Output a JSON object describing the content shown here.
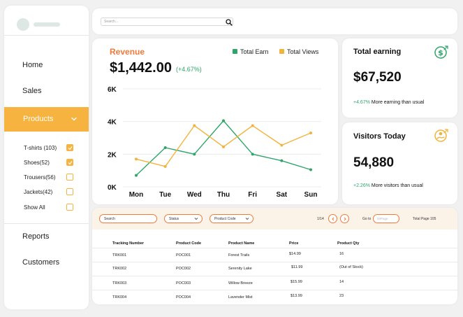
{
  "sidebar": {
    "nav_top": [
      {
        "label": "Home"
      },
      {
        "label": "Sales"
      }
    ],
    "active": {
      "label": "Products"
    },
    "categories": [
      {
        "label": "T-shirts (103)",
        "checked": true
      },
      {
        "label": "Shoes(52)",
        "checked": true
      },
      {
        "label": "Trousers(56)",
        "checked": false
      },
      {
        "label": "Jackets(42)",
        "checked": false
      },
      {
        "label": "Show All",
        "checked": false
      }
    ],
    "nav_bottom": [
      {
        "label": "Reports"
      },
      {
        "label": "Customers"
      }
    ]
  },
  "topbar": {
    "search_placeholder": "Search..."
  },
  "revenue": {
    "title": "Revenue",
    "amount": "$1,442.00",
    "change": "(+4.67%)"
  },
  "chart_data": {
    "type": "line",
    "categories": [
      "Mon",
      "Tue",
      "Wed",
      "Thu",
      "Fri",
      "Sat",
      "Sun"
    ],
    "yticks": [
      "6K",
      "4K",
      "2K",
      "0K"
    ],
    "ylim": [
      0,
      6000
    ],
    "grid": true,
    "legend_position": "top-right",
    "series": [
      {
        "name": "Total Earn",
        "color": "#2fa56a",
        "values": [
          700,
          2400,
          2000,
          4050,
          2000,
          1600,
          1050
        ]
      },
      {
        "name": "Total Views",
        "color": "#f2b33d",
        "values": [
          1700,
          1250,
          3750,
          2450,
          3750,
          2550,
          3300
        ]
      }
    ]
  },
  "stats": {
    "earning": {
      "title": "Total earning",
      "value": "$67,520",
      "pct": "+4.67%",
      "note": " More earning than usual"
    },
    "visitors": {
      "title": "Visitors Today",
      "value": "54,880",
      "pct": "+2.26%",
      "note": " More visitors than usual"
    }
  },
  "table": {
    "filters": {
      "search": "Search",
      "status": "Status",
      "product_code": "Product Code",
      "page": "1/14",
      "goto_label": "Go to",
      "goto_placeholder": "00Page",
      "total": "Total Page 105"
    },
    "headers": [
      "Tracking Number",
      "Product Code",
      "Product Name",
      "Price",
      "Product Qty"
    ],
    "rows": [
      [
        "TRK001",
        "POC001",
        "Forest Trails",
        "$14.99",
        "16"
      ],
      [
        "TRK002",
        "POC002",
        "Serenity Lake",
        "$11.99",
        "(Out of Stock)"
      ],
      [
        "TRK003",
        "POC003",
        "Willow Breeze",
        "$15.99",
        "14"
      ],
      [
        "TRK004",
        "POC004",
        "Lavender Mist",
        "$13.99",
        "23"
      ]
    ]
  },
  "colors": {
    "accent": "#f6b33f",
    "orange": "#ee7a3b",
    "green": "#2fa56a"
  }
}
